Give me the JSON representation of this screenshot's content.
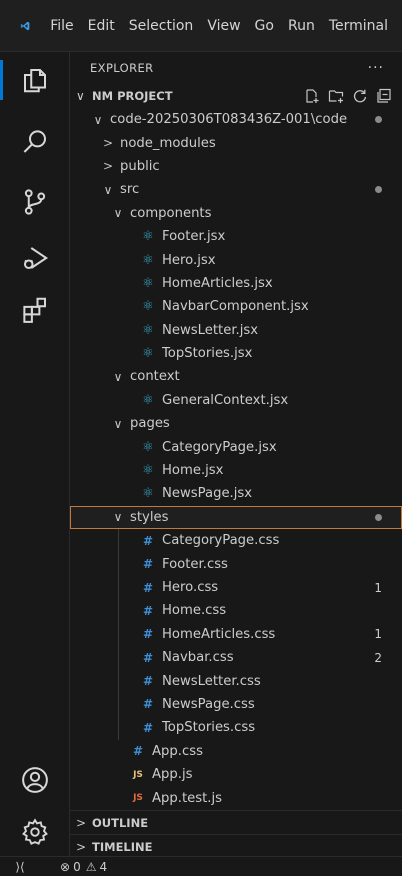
{
  "menu": [
    "File",
    "Edit",
    "Selection",
    "View",
    "Go",
    "Run",
    "Terminal"
  ],
  "explorer": {
    "title": "EXPLORER",
    "more": "···"
  },
  "project": {
    "name": "NM PROJECT"
  },
  "tree": [
    {
      "label": "code-20250306T083436Z-001\\code",
      "depth": 0,
      "kind": "folder",
      "open": true,
      "dot": true
    },
    {
      "label": "node_modules",
      "depth": 1,
      "kind": "folder",
      "open": false
    },
    {
      "label": "public",
      "depth": 1,
      "kind": "folder",
      "open": false
    },
    {
      "label": "src",
      "depth": 1,
      "kind": "folder",
      "open": true,
      "dot": true
    },
    {
      "label": "components",
      "depth": 2,
      "kind": "folder",
      "open": true
    },
    {
      "label": "Footer.jsx",
      "depth": 3,
      "kind": "jsx"
    },
    {
      "label": "Hero.jsx",
      "depth": 3,
      "kind": "jsx"
    },
    {
      "label": "HomeArticles.jsx",
      "depth": 3,
      "kind": "jsx"
    },
    {
      "label": "NavbarComponent.jsx",
      "depth": 3,
      "kind": "jsx"
    },
    {
      "label": "NewsLetter.jsx",
      "depth": 3,
      "kind": "jsx"
    },
    {
      "label": "TopStories.jsx",
      "depth": 3,
      "kind": "jsx"
    },
    {
      "label": "context",
      "depth": 2,
      "kind": "folder",
      "open": true
    },
    {
      "label": "GeneralContext.jsx",
      "depth": 3,
      "kind": "jsx"
    },
    {
      "label": "pages",
      "depth": 2,
      "kind": "folder",
      "open": true
    },
    {
      "label": "CategoryPage.jsx",
      "depth": 3,
      "kind": "jsx"
    },
    {
      "label": "Home.jsx",
      "depth": 3,
      "kind": "jsx"
    },
    {
      "label": "NewsPage.jsx",
      "depth": 3,
      "kind": "jsx"
    },
    {
      "label": "styles",
      "depth": 2,
      "kind": "folder",
      "open": true,
      "dot": true,
      "selected": true
    },
    {
      "label": "CategoryPage.css",
      "depth": 3,
      "kind": "css"
    },
    {
      "label": "Footer.css",
      "depth": 3,
      "kind": "css"
    },
    {
      "label": "Hero.css",
      "depth": 3,
      "kind": "css",
      "badge": "1"
    },
    {
      "label": "Home.css",
      "depth": 3,
      "kind": "css"
    },
    {
      "label": "HomeArticles.css",
      "depth": 3,
      "kind": "css",
      "badge": "1"
    },
    {
      "label": "Navbar.css",
      "depth": 3,
      "kind": "css",
      "badge": "2"
    },
    {
      "label": "NewsLetter.css",
      "depth": 3,
      "kind": "css"
    },
    {
      "label": "NewsPage.css",
      "depth": 3,
      "kind": "css"
    },
    {
      "label": "TopStories.css",
      "depth": 3,
      "kind": "css"
    },
    {
      "label": "App.css",
      "depth": 2,
      "kind": "css"
    },
    {
      "label": "App.js",
      "depth": 2,
      "kind": "js"
    },
    {
      "label": "App.test.js",
      "depth": 2,
      "kind": "jstest"
    }
  ],
  "icons": {
    "css": "#",
    "js": "JS",
    "jsx": "⚛",
    "chev_open": "∨",
    "chev_closed": ">"
  },
  "sections": {
    "outline": "OUTLINE",
    "timeline": "TIMELINE"
  },
  "status": {
    "errors": "0",
    "warnings": "4"
  },
  "colors": {
    "accent": "#0078d4",
    "selected_outline": "#c0793a",
    "react": "#3aa6c6",
    "css": "#3f8fd6",
    "js": "#e5c07b"
  }
}
